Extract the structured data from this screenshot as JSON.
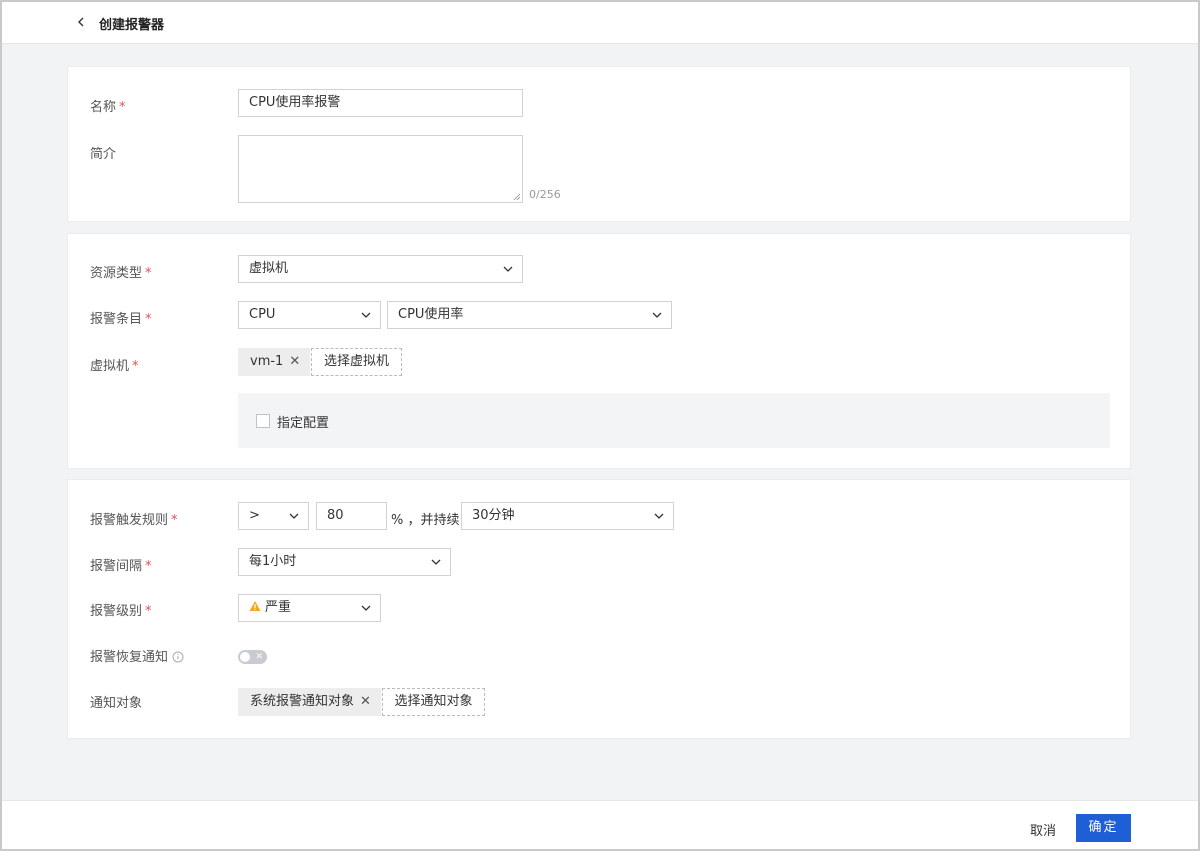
{
  "header": {
    "title": "创建报警器"
  },
  "basic": {
    "name_label": "名称",
    "name_value": "CPU使用率报警",
    "desc_label": "简介",
    "desc_counter": "0/256"
  },
  "resource": {
    "type_label": "资源类型",
    "type_value": "虚拟机",
    "item_label": "报警条目",
    "item_category": "CPU",
    "item_metric": "CPU使用率",
    "vm_label": "虚拟机",
    "vm_tag": "vm-1",
    "select_vm_button": "选择虚拟机",
    "specify_config_label": "指定配置"
  },
  "rules": {
    "trigger_label": "报警触发规则",
    "operator": ">",
    "threshold": "80",
    "unit_text": "%  ，并持续",
    "duration": "30分钟",
    "interval_label": "报警间隔",
    "interval_value": "每1小时",
    "level_label": "报警级别",
    "level_value": "严重",
    "recovery_label": "报警恢复通知",
    "recovery_enabled": false,
    "notify_label": "通知对象",
    "notify_tag": "系统报警通知对象",
    "select_notify_button": "选择通知对象"
  },
  "footer": {
    "cancel_label": "取消",
    "ok_label": "确定"
  },
  "colors": {
    "primary": "#1f5fd6",
    "required": "#e34d59",
    "warning": "#f5a623"
  }
}
